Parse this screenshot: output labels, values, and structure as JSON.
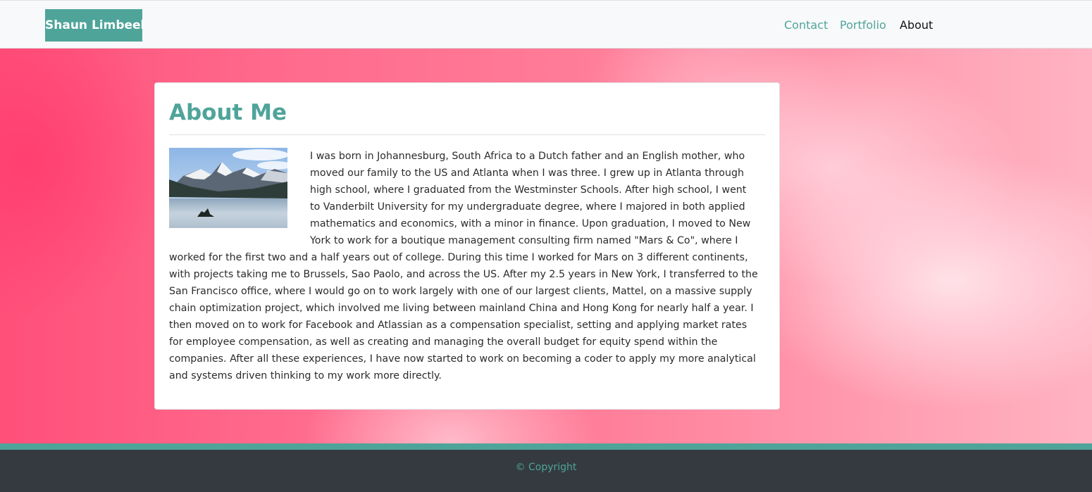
{
  "navbar": {
    "brand": "Shaun Limbeek",
    "links": [
      {
        "label": "Contact",
        "active": false
      },
      {
        "label": "Portfolio",
        "active": false
      },
      {
        "label": "About",
        "active": true
      }
    ]
  },
  "about": {
    "title": "About Me",
    "image_description": "mountain lake landscape",
    "paragraph": "I was born in Johannesburg, South Africa to a Dutch father and an English mother, who moved our family to the US and Atlanta when I was three. I grew up in Atlanta through high school, where I graduated from the Westminster Schools. After high school, I went to Vanderbilt University for my undergraduate degree, where I majored in both applied mathematics and economics, with a minor in finance. Upon graduation, I moved to New York to work for a boutique management consulting firm named \"Mars & Co\", where I worked for the first two and a half years out of college. During this time I worked for Mars on 3 different continents, with projects taking me to Brussels, Sao Paolo, and across the US. After my 2.5 years in New York, I transferred to the San Francisco office, where I would go on to work largely with one of our largest clients, Mattel, on a massive supply chain optimization project, which involved me living between mainland China and Hong Kong for nearly half a year. I then moved on to work for Facebook and Atlassian as a compensation specialist, setting and applying market rates for employee compensation, as well as creating and managing the overall budget for equity spend within the companies. After all these experiences, I have now started to work on becoming a coder to apply my more analytical and systems driven thinking to my work more directly."
  },
  "footer": {
    "copyright": "© Copyright"
  },
  "colors": {
    "accent": "#4fa49a",
    "footer_bg": "#343a40",
    "hero_pink": "#ff6a8c"
  }
}
